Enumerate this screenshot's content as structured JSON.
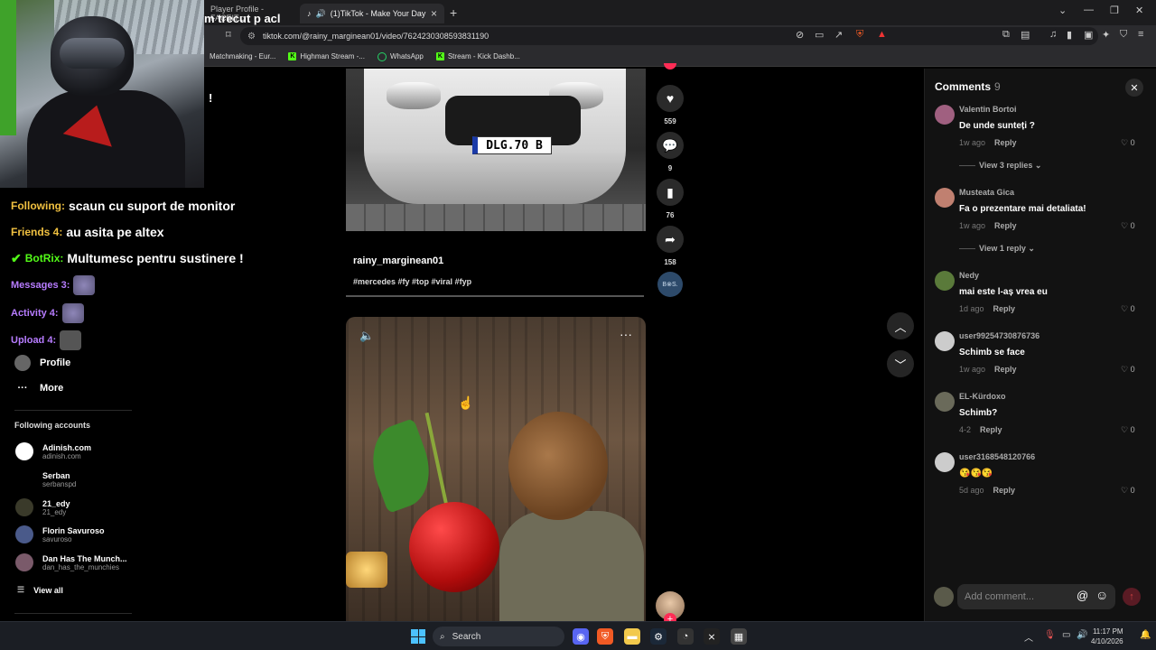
{
  "browser": {
    "tabs": [
      {
        "label": "Player Profile - FACEIT.c",
        "active": false
      },
      {
        "label": "(1)TikTok - Make Your Day",
        "active": true
      }
    ],
    "url": "tiktok.com/@rainy_marginean01/video/7624230308593831190",
    "bookmarks": [
      {
        "label": "Matchmaking - Eur...",
        "icon": "none"
      },
      {
        "label": "Highman Stream -...",
        "icon": "kick-icon"
      },
      {
        "label": "WhatsApp",
        "icon": "whatsapp-icon"
      },
      {
        "label": "Stream - Kick Dashb...",
        "icon": "kick-icon"
      }
    ]
  },
  "stream_overlay": {
    "top_text": "m trecut p acl",
    "exclaim": "!",
    "chat": [
      {
        "user": "Following:",
        "msg": "scaun cu suport de monitor"
      },
      {
        "user": "Friends 4:",
        "msg": "au asita pe altex"
      },
      {
        "user": "BotRix:",
        "msg": "Multumesc pentru sustinere !"
      },
      {
        "user": "Messages 3:",
        "msg": ""
      },
      {
        "user": "Activity 4:",
        "msg": ""
      },
      {
        "user": "Upload 4:",
        "msg": ""
      }
    ]
  },
  "sidebar": {
    "items": [
      {
        "label": "Profile",
        "icon": "profile-icon"
      },
      {
        "label": "More",
        "icon": "more-icon"
      }
    ],
    "following_title": "Following accounts",
    "accounts": [
      {
        "name": "Adinish.com",
        "handle": "adinish.com"
      },
      {
        "name": "Serban",
        "handle": "serbanspd"
      },
      {
        "name": "21_edy",
        "handle": "21_edy"
      },
      {
        "name": "Florin Savuroso",
        "handle": "savuroso"
      },
      {
        "name": "Dan Has The Munch...",
        "handle": "dan_has_the_munchies"
      }
    ],
    "view_all": "View all"
  },
  "video1": {
    "plate": "DLG.70 B",
    "author": "rainy_marginean01",
    "tags": "#mercedes #fy #top #viral #fyp"
  },
  "actions": {
    "likes": "559",
    "comments": "9",
    "saves": "76",
    "shares": "158",
    "music_label": "B⊗S."
  },
  "comments_panel": {
    "title": "Comments",
    "count": "9",
    "input_placeholder": "Add comment...",
    "reply_label": "Reply",
    "items": [
      {
        "user": "Valentin Bortoi",
        "text": "De unde sunteți ?",
        "time": "1w ago",
        "likes": "0",
        "replies": "View 3 replies"
      },
      {
        "user": "Musteata Gica",
        "text": "Fa o prezentare mai detaliata!",
        "time": "1w ago",
        "likes": "0",
        "replies": "View 1 reply"
      },
      {
        "user": "Nedy",
        "text": "mai este l-aș vrea eu",
        "time": "1d ago",
        "likes": "0",
        "replies": ""
      },
      {
        "user": "user99254730876736",
        "text": "Schimb se face",
        "time": "1w ago",
        "likes": "0",
        "replies": ""
      },
      {
        "user": "EL-Kürdoxo",
        "text": "Schimb?",
        "time": "4-2",
        "likes": "0",
        "replies": ""
      },
      {
        "user": "user3168548120766",
        "text": "😘😘😘",
        "time": "5d ago",
        "likes": "0",
        "replies": ""
      }
    ]
  },
  "taskbar": {
    "search": "Search",
    "time": "11:17 PM",
    "date": "4/10/2026"
  },
  "colors": {
    "tiktok_red": "#fe2c55",
    "kick_green": "#53fc18",
    "panel_bg": "#121212"
  }
}
